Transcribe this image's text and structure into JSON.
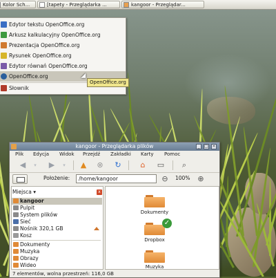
{
  "taskbar": {
    "tasks": [
      {
        "label": "Kolor Sch..."
      },
      {
        "label": "[tapety - Przeglądarka ..."
      },
      {
        "label": "kangoor - Przeglądar..."
      }
    ]
  },
  "menu": {
    "items": [
      {
        "label": "Edytor tekstu OpenOffice.org",
        "color": "#3a6fc4"
      },
      {
        "label": "Arkusz kalkulacyjny OpenOffice.org",
        "color": "#3e9a3e"
      },
      {
        "label": "Prezentacja OpenOffice.org",
        "color": "#d07a2e"
      },
      {
        "label": "Rysunek OpenOffice.org",
        "color": "#d6b52a"
      },
      {
        "label": "Edytor równań OpenOffice.org",
        "color": "#7a5aa8"
      },
      {
        "label": "OpenOffice.org",
        "color": "#2a5e9c"
      },
      {
        "label": "Słownik",
        "color": "#b03a2a"
      }
    ],
    "tooltip": "OpenOffice.org"
  },
  "window": {
    "title": "kangoor - Przeglądarka plików",
    "menubar": [
      "Plik",
      "Edycja",
      "Widok",
      "Przejdź",
      "Zakładki",
      "Karty",
      "Pomoc"
    ],
    "location_label": "Położenie:",
    "location_value": "/home/kangoor",
    "zoom": "100%",
    "places_header": "Miejsca",
    "places": [
      {
        "label": "kangoor",
        "color": "#e08a36"
      },
      {
        "label": "Pulpit",
        "color": "#8a8a8a"
      },
      {
        "label": "System plików",
        "color": "#8a8a8a"
      },
      {
        "label": "Sieć",
        "color": "#4a6ea8"
      },
      {
        "label": "Nośnik 320,1 GB",
        "color": "#8a8a8a"
      },
      {
        "label": "Kosz",
        "color": "#9a9a9a"
      }
    ],
    "bookmarks": [
      {
        "label": "Dokumenty"
      },
      {
        "label": "Muzyka"
      },
      {
        "label": "Obrazy"
      },
      {
        "label": "Wideo"
      }
    ],
    "files": [
      {
        "label": "Dokumenty"
      },
      {
        "label": "Dropbox"
      },
      {
        "label": "Muzyka"
      }
    ],
    "status": "7 elementów, wolna przestrzeń: 116,0 GB"
  }
}
